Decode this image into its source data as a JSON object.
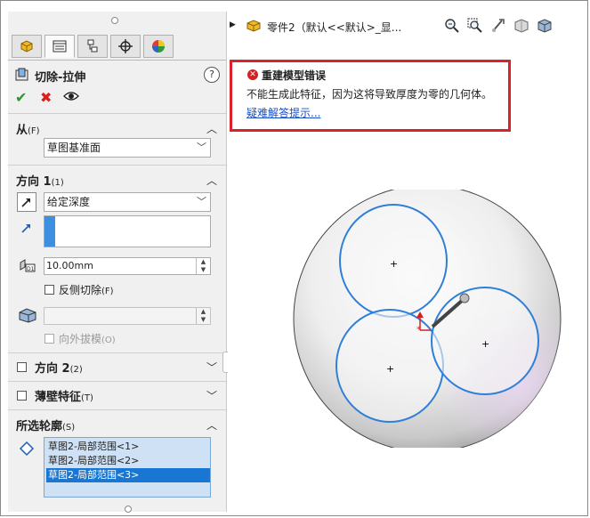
{
  "feature": {
    "title": "切除-拉伸",
    "help": "?",
    "ok": "✔",
    "cancel": "✖",
    "preview": "👁"
  },
  "tabs": [
    "feature-manager",
    "property-manager",
    "configuration-manager",
    "dimxpert",
    "display-manager"
  ],
  "from": {
    "label": "从",
    "hotkey": "(F)",
    "value": "草图基准面"
  },
  "direction1": {
    "label": "方向 1",
    "hotkey": "(1)",
    "end_condition": "给定深度",
    "depth": "10.00mm",
    "flip_side_label": "反侧切除",
    "flip_side_hotkey": "(F)",
    "draft_outward_label": "向外拔模",
    "draft_outward_hotkey": "(O)"
  },
  "direction2": {
    "label": "方向 2",
    "hotkey": "(2)"
  },
  "thin_feature": {
    "label": "薄壁特征",
    "hotkey": "(T)"
  },
  "selected_contours": {
    "label": "所选轮廓",
    "hotkey": "(S)",
    "items": [
      "草图2-局部范围<1>",
      "草图2-局部范围<2>",
      "草图2-局部范围<3>"
    ],
    "selected_index": 2
  },
  "tree": {
    "part_name": "零件2（默认<<默认>_显..."
  },
  "error": {
    "title": "重建模型错误",
    "message": "不能生成此特征，因为这将导致厚度为零的几何体。",
    "link": "疑难解答提示..."
  },
  "toolbar": [
    "zoom-to-fit-icon",
    "zoom-to-area-icon",
    "previous-view-icon",
    "section-view-icon",
    "view-orientation-icon"
  ],
  "colors": {
    "error_border": "#d8232a",
    "selection": "#1976d2",
    "sketch": "#2f7fd8",
    "link": "#1a4fc4"
  }
}
